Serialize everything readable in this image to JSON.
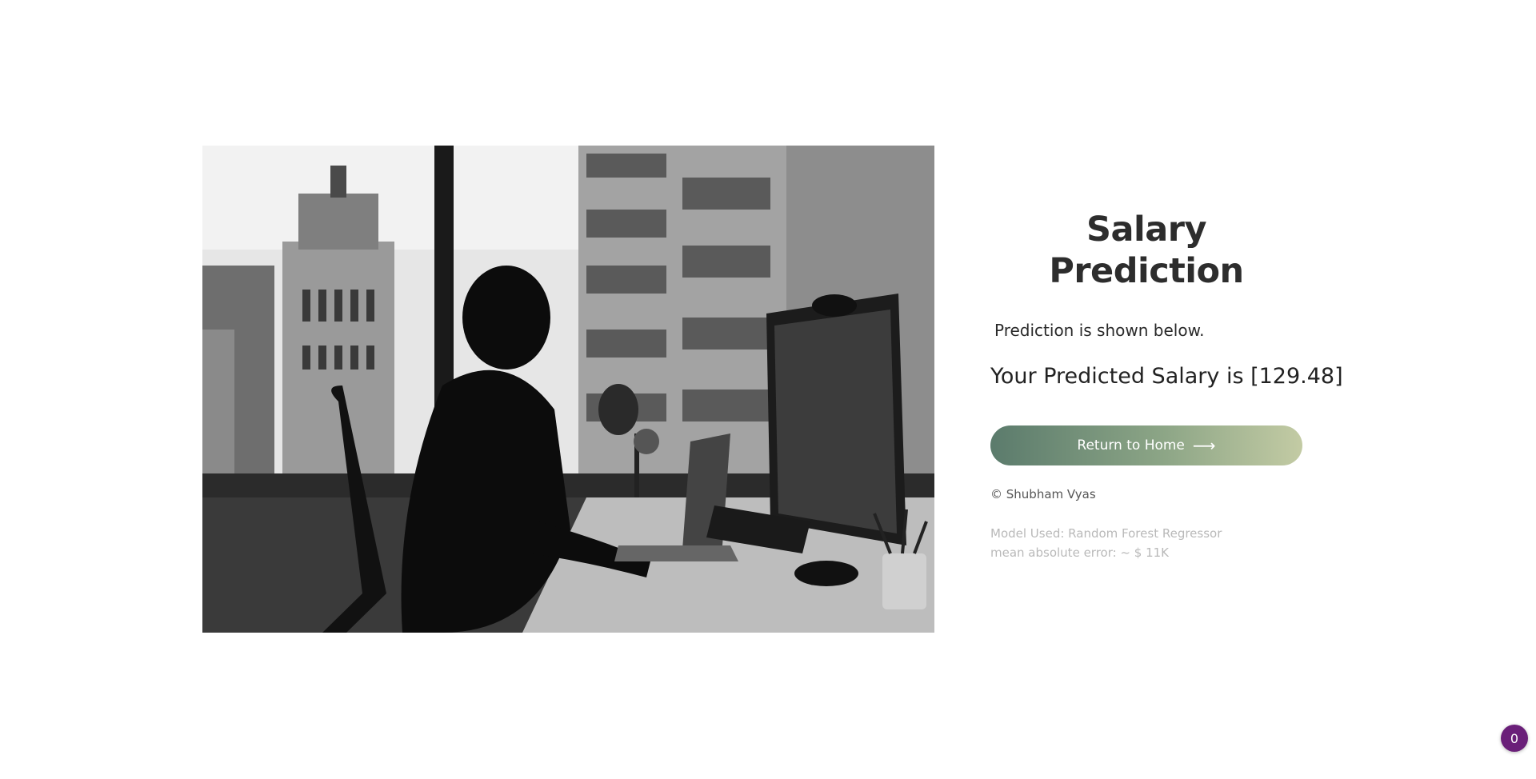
{
  "hero_image": {
    "description_icon": "office-worker-photo-icon"
  },
  "panel": {
    "title": "Salary Prediction",
    "subtitle": "Prediction is shown below.",
    "result": "Your Predicted Salary is [129.48]",
    "home_button": {
      "label": "Return to Home",
      "icon": "arrow-right-icon"
    },
    "copyright": "© Shubham Vyas",
    "model_used": "Model Used: Random Forest Regressor",
    "mean_error": "mean absolute error: ~ $ 11K"
  },
  "badge": {
    "count": "0",
    "color": "#6a1f79"
  },
  "colors": {
    "button_gradient_start": "#5b7b6c",
    "button_gradient_end": "#c3cba4",
    "title": "#2d2d2d",
    "muted": "#b9b9b9"
  }
}
